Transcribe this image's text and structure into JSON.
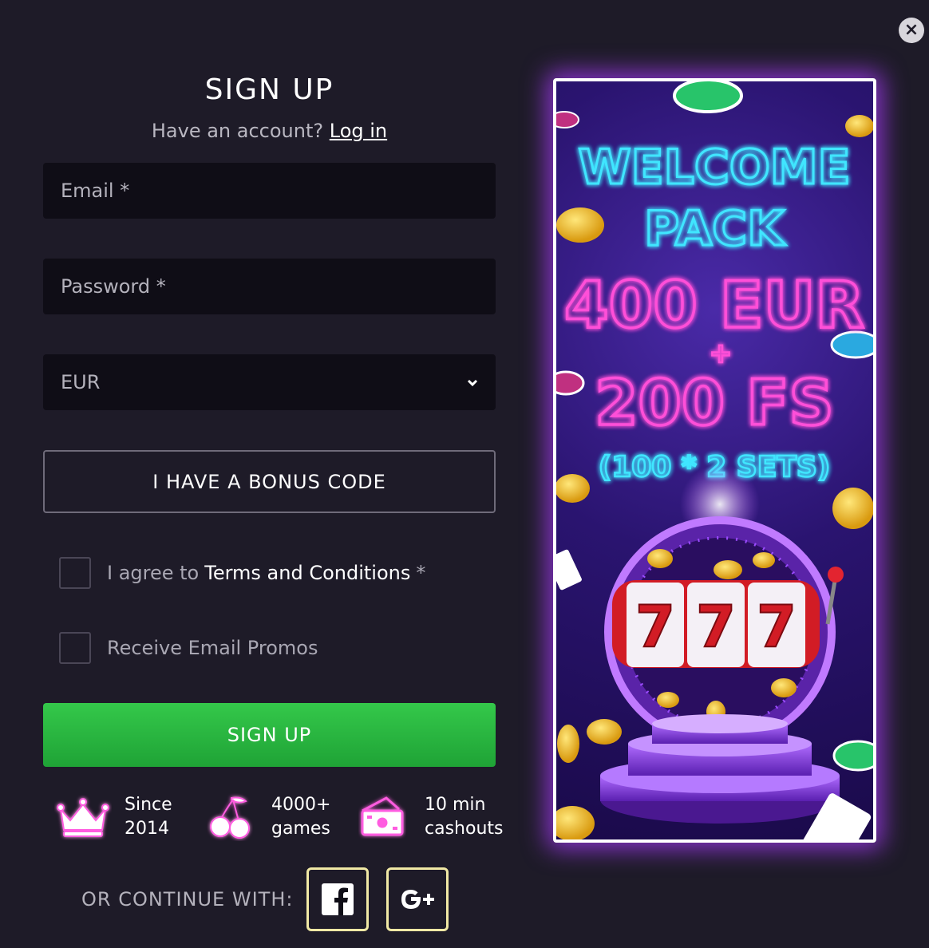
{
  "form": {
    "title": "SIGN UP",
    "have_account": "Have an account?",
    "login_link": "Log in",
    "email_placeholder": "Email *",
    "password_placeholder": "Password *",
    "currency_value": "EUR",
    "bonus_button": "I HAVE A BONUS CODE",
    "terms_prefix": "I agree to",
    "terms_link": "Terms and Conditions",
    "terms_required": "*",
    "promos_label": "Receive Email Promos",
    "signup_button": "SIGN UP"
  },
  "features": [
    {
      "icon": "crown-icon",
      "line1": "Since",
      "line2": "2014"
    },
    {
      "icon": "cherries-icon",
      "line1": "4000+",
      "line2": "games"
    },
    {
      "icon": "cash-icon",
      "line1": "10 min",
      "line2": "cashouts"
    }
  ],
  "social": {
    "label": "OR CONTINUE WITH:",
    "facebook_icon": "facebook-icon",
    "google_icon": "google-plus-icon"
  },
  "banner": {
    "line1": "WELCOME",
    "line2": "PACK",
    "line3": "400 EUR",
    "plus": "+",
    "line4": "200 FS",
    "line5": "(100 * 2 SETS)",
    "reel1": "7",
    "reel2": "7",
    "reel3": "7"
  },
  "colors": {
    "background": "#1e1b28",
    "input_bg": "#0f0d16",
    "signup_green": "#2bb842",
    "social_border": "#f1e9a5",
    "neon_pink": "#ff4fd8",
    "neon_cyan": "#3fe6ff"
  }
}
